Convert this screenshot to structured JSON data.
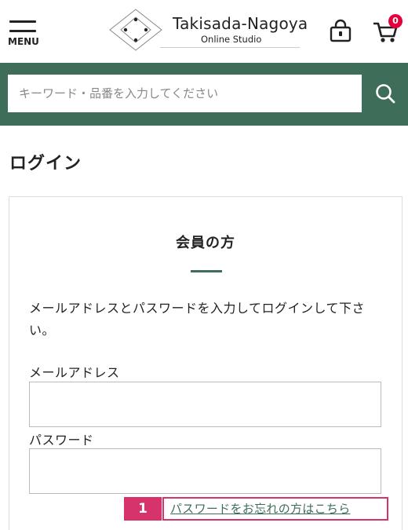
{
  "header": {
    "menu_label": "MENU",
    "logo_title": "Takisada-Nagoya",
    "logo_subtitle": "Online Studio",
    "cart_count": "0"
  },
  "search": {
    "placeholder": "キーワード・品番を入力してください"
  },
  "page": {
    "title": "ログイン"
  },
  "login_card": {
    "title": "会員の方",
    "description": "メールアドレスとパスワードを入力してログインして下さい。",
    "email_label": "メールアドレス",
    "email_value": "",
    "password_label": "パスワード",
    "password_value": "",
    "forgot_link": "パスワードをお忘れの方はこちら"
  },
  "annotation": {
    "marker_number": "1"
  },
  "colors": {
    "brand_green": "#3e6e5a",
    "badge_red": "#e4003a",
    "annotation_pink": "#d6336c"
  }
}
